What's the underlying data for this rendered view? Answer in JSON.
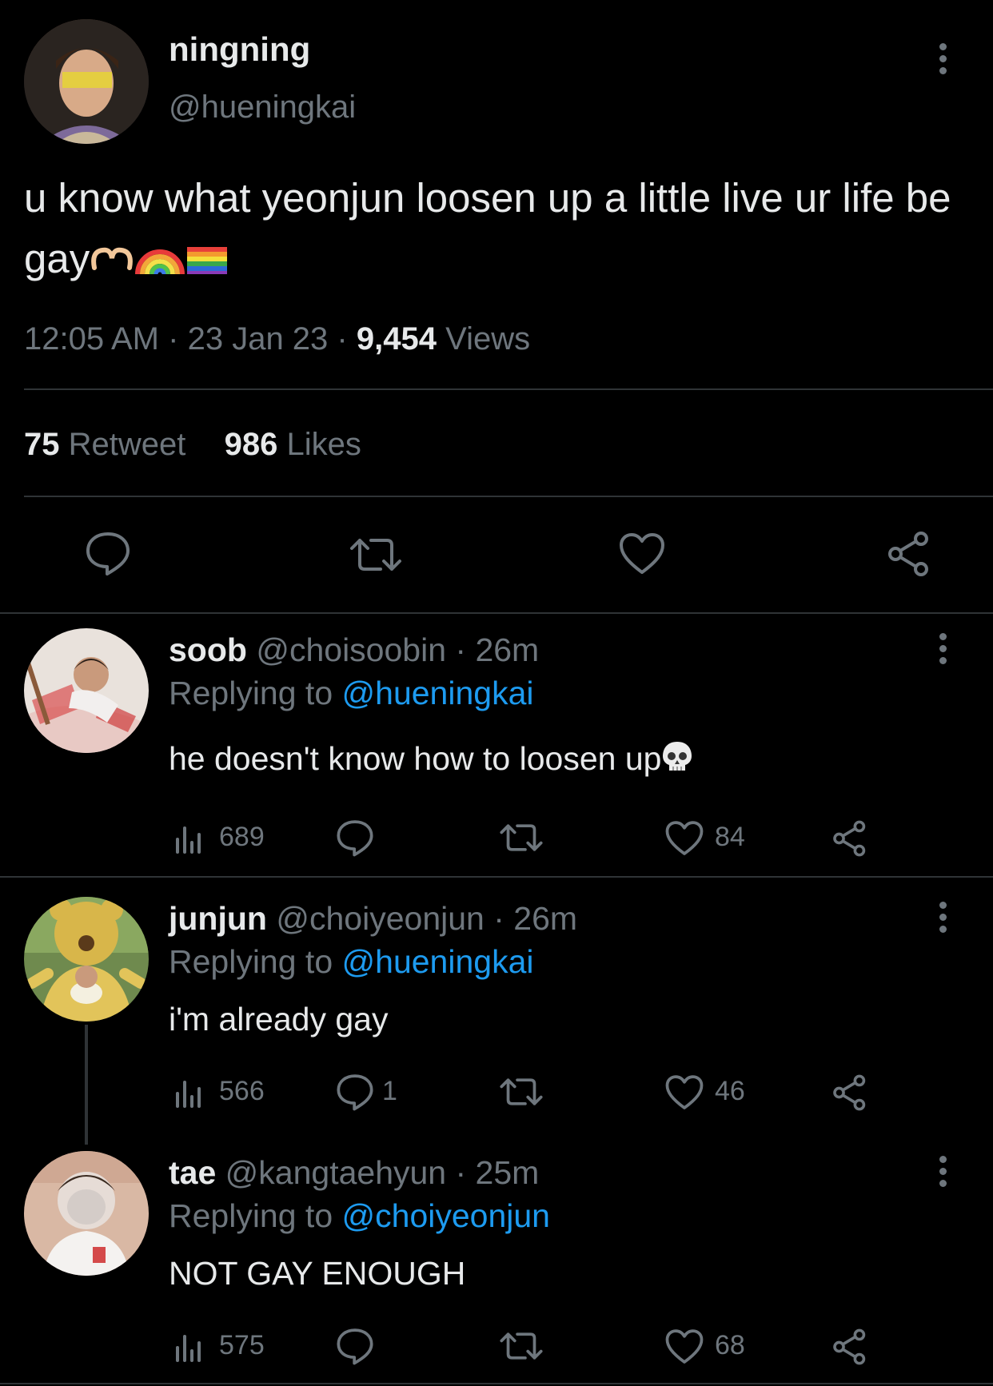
{
  "tweet": {
    "display_name": "ningning",
    "handle": "@hueningkai",
    "text": "u know what yeonjun loosen up a little live ur life be gay",
    "emojis": [
      "hand-heart-icon",
      "rainbow-icon",
      "rainbow-flag-icon"
    ],
    "time": "12:05 AM",
    "sep": "·",
    "date": "23 Jan 23",
    "views_count": "9,454",
    "views_label": "Views",
    "retweets_count": "75",
    "retweets_label": "Retweet",
    "likes_count": "986",
    "likes_label": "Likes"
  },
  "replies": [
    {
      "display_name": "soob",
      "handle": "@choisoobin",
      "time": "· 26m",
      "replying_label": "Replying to",
      "replying_to": "@hueningkai",
      "text": "he doesn't know how to loosen up",
      "emoji": "skull-icon",
      "views": "689",
      "comments": "",
      "likes": "84"
    },
    {
      "display_name": "junjun",
      "handle": "@choiyeonjun",
      "time": "· 26m",
      "replying_label": "Replying to",
      "replying_to": "@hueningkai",
      "text": "i'm already gay",
      "views": "566",
      "comments": "1",
      "likes": "46"
    },
    {
      "display_name": "tae",
      "handle": "@kangtaehyun",
      "time": "· 25m",
      "replying_label": "Replying to",
      "replying_to": "@choiyeonjun",
      "text": "NOT GAY ENOUGH",
      "views": "575",
      "comments": "",
      "likes": "68"
    }
  ],
  "colors": {
    "background": "#000000",
    "text": "#e7e9ea",
    "muted": "#6e767d",
    "link": "#1d9bf0",
    "divider": "#2f3336"
  }
}
